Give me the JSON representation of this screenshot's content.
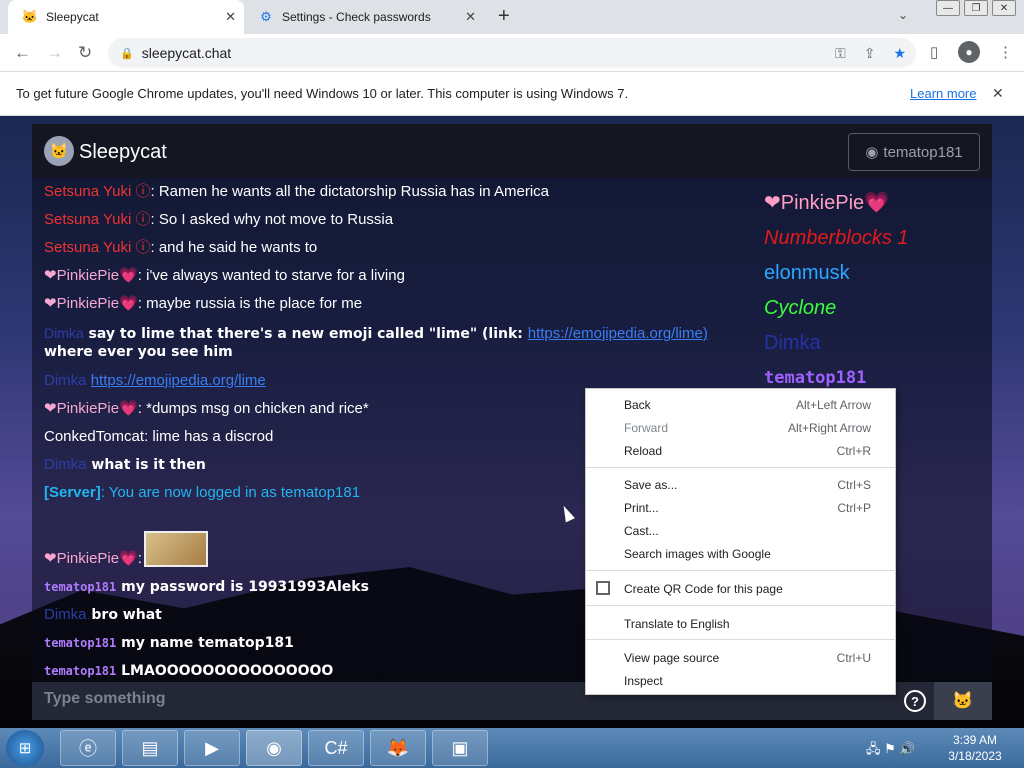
{
  "browser": {
    "tabs": [
      {
        "title": "Sleepycat",
        "icon": "cat-icon",
        "close": "✕"
      },
      {
        "title": "Settings - Check passwords",
        "icon": "gear-icon",
        "close": "✕"
      }
    ],
    "new_tab": "+",
    "url": "sleepycat.chat",
    "infobar": {
      "text": "To get future Google Chrome updates, you'll need Windows 10 or later. This computer is using Windows 7.",
      "link": "Learn more",
      "close": "✕"
    }
  },
  "app": {
    "title": "Sleepycat",
    "username": "tematop181",
    "input_placeholder": "Type something",
    "help": "?",
    "messages": [
      {
        "name": "Setsuna Yuki ⓘ",
        "sep": ": ",
        "text": "Ramen he wants all the dictatorship Russia has in America"
      },
      {
        "name": "Setsuna Yuki ⓘ",
        "sep": ": ",
        "text": "So I asked why not move to Russia"
      },
      {
        "name": "Setsuna Yuki ⓘ",
        "sep": ": ",
        "text": "and he said he wants to"
      },
      {
        "name": "❤PinkiePie💗",
        "sep": ": ",
        "text": "i've always wanted to starve for a living"
      },
      {
        "name": "❤PinkiePie💗",
        "sep": ": ",
        "text": "maybe russia is the place for me"
      },
      {
        "name": "Dimka",
        "sep": " ",
        "text": "say to lime that there's a new emoji called \"lime\" (link: ",
        "link": "https://emojipedia.org/lime)",
        "text2": " where ever you see him"
      },
      {
        "name": "Dimka",
        "sep": " ",
        "link": "https://emojipedia.org/lime"
      },
      {
        "name": "❤PinkiePie💗",
        "sep": ": ",
        "text": "*dumps msg on chicken and rice*"
      },
      {
        "name": "ConkedTomcat",
        "sep": ": ",
        "text": "lime has a discrod"
      },
      {
        "name": "Dimka",
        "sep": " ",
        "text": "what is it then"
      },
      {
        "name": "[Server]",
        "sep": ": ",
        "text": "You are now logged in as tematop181"
      },
      {
        "name": "❤PinkiePie💗",
        "sep": ":"
      },
      {
        "name": "tematop181",
        "sep": " ",
        "text": "my password is 19931993Aleks"
      },
      {
        "name": "Dimka",
        "sep": " ",
        "text": "bro what"
      },
      {
        "name": "tematop181",
        "sep": " ",
        "text": "my name tematop181"
      },
      {
        "name": "tematop181",
        "sep": " ",
        "text": "LMAOOOOOOOOOOOOOOO"
      }
    ],
    "online_users": [
      "❤PinkiePie💗",
      "Numberblocks 1",
      "elonmusk",
      "Cyclone",
      "Dimka",
      "tematop181"
    ]
  },
  "context_menu": {
    "items": [
      {
        "label": "Back",
        "shortcut": "Alt+Left Arrow"
      },
      {
        "label": "Forward",
        "shortcut": "Alt+Right Arrow"
      },
      {
        "label": "Reload",
        "shortcut": "Ctrl+R"
      },
      {
        "label": "Save as...",
        "shortcut": "Ctrl+S"
      },
      {
        "label": "Print...",
        "shortcut": "Ctrl+P"
      },
      {
        "label": "Cast...",
        "shortcut": ""
      },
      {
        "label": "Search images with Google",
        "shortcut": ""
      },
      {
        "label": "Create QR Code for this page",
        "shortcut": ""
      },
      {
        "label": "Translate to English",
        "shortcut": ""
      },
      {
        "label": "View page source",
        "shortcut": "Ctrl+U"
      },
      {
        "label": "Inspect",
        "shortcut": ""
      }
    ]
  },
  "taskbar": {
    "time": "3:39 AM",
    "date": "3/18/2023"
  }
}
